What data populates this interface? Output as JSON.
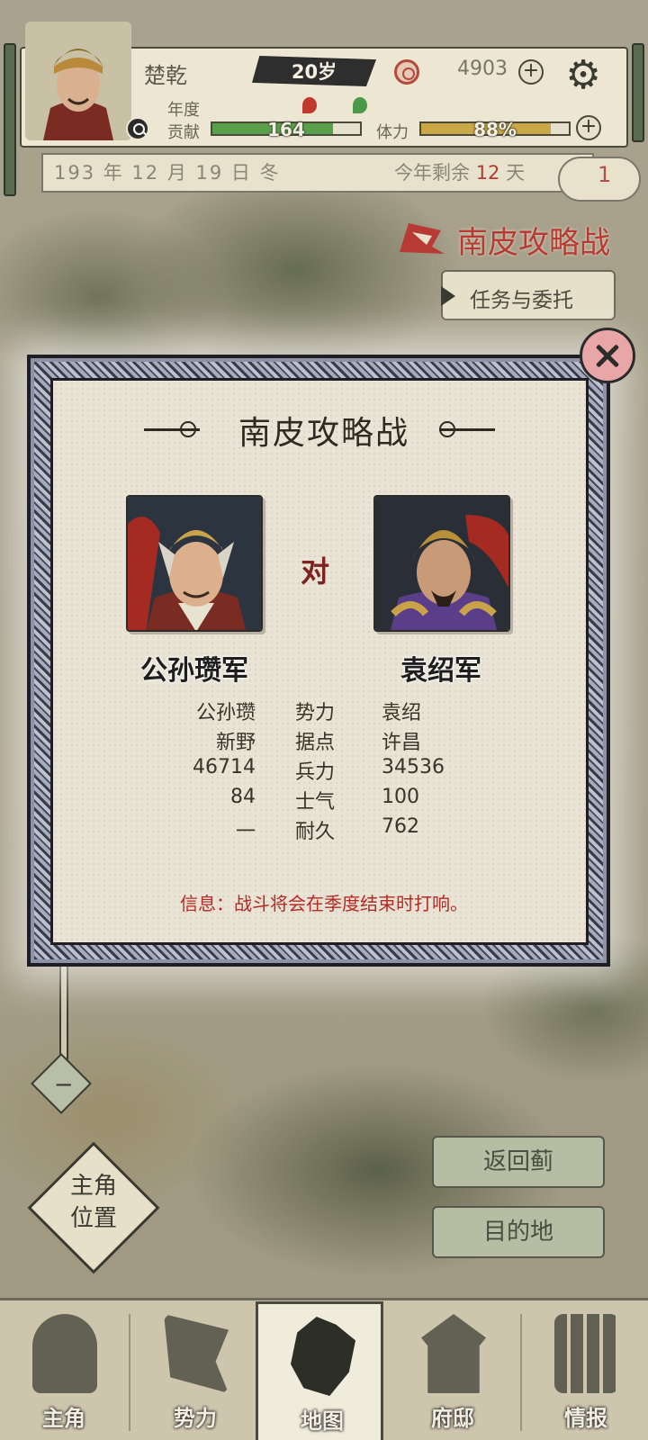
{
  "player": {
    "name": "楚乾",
    "age": "20岁",
    "coins": "4903",
    "contribution_label_1": "年度",
    "contribution_label_2": "贡献",
    "contribution_value": "164",
    "contribution_fraction": 0.82,
    "stamina_label": "体力",
    "stamina_value": "88%",
    "stamina_fraction": 0.88
  },
  "calendar": {
    "date": "193 年 12 月 19 日 冬",
    "remaining_prefix": "今年剩余",
    "remaining_days": "12",
    "remaining_suffix": "天",
    "badge": "1"
  },
  "quest": {
    "title": "南皮攻略战",
    "task_button": "任务与委托"
  },
  "battle": {
    "title": "南皮攻略战",
    "vs": "对",
    "left_army": "公孙瓒军",
    "right_army": "袁绍军",
    "stats": [
      {
        "left": "公孙瓒",
        "label": "势力",
        "right": "袁绍"
      },
      {
        "left": "新野",
        "label": "据点",
        "right": "许昌"
      },
      {
        "left": "46714",
        "label": "兵力",
        "right": "34536"
      },
      {
        "left": "84",
        "label": "士气",
        "right": "100"
      },
      {
        "left": "一",
        "label": "耐久",
        "right": "762"
      }
    ],
    "info": "信息：战斗将会在季度结束时打响。"
  },
  "map_controls": {
    "zoom_out": "−",
    "player_position_1": "主角",
    "player_position_2": "位置",
    "return_button": "返回蓟",
    "destination_button": "目的地"
  },
  "nav": [
    {
      "label": "主角",
      "icon": "general-helmet-icon"
    },
    {
      "label": "势力",
      "icon": "flag-icon"
    },
    {
      "label": "地图",
      "icon": "map-icon"
    },
    {
      "label": "府邸",
      "icon": "mansion-icon"
    },
    {
      "label": "情报",
      "icon": "scroll-icon"
    }
  ],
  "colors": {
    "accent_red": "#b73a34",
    "contribution_bar": "#5aa04a",
    "stamina_bar": "#c9a845",
    "modal_frame": "#8c93a6"
  }
}
